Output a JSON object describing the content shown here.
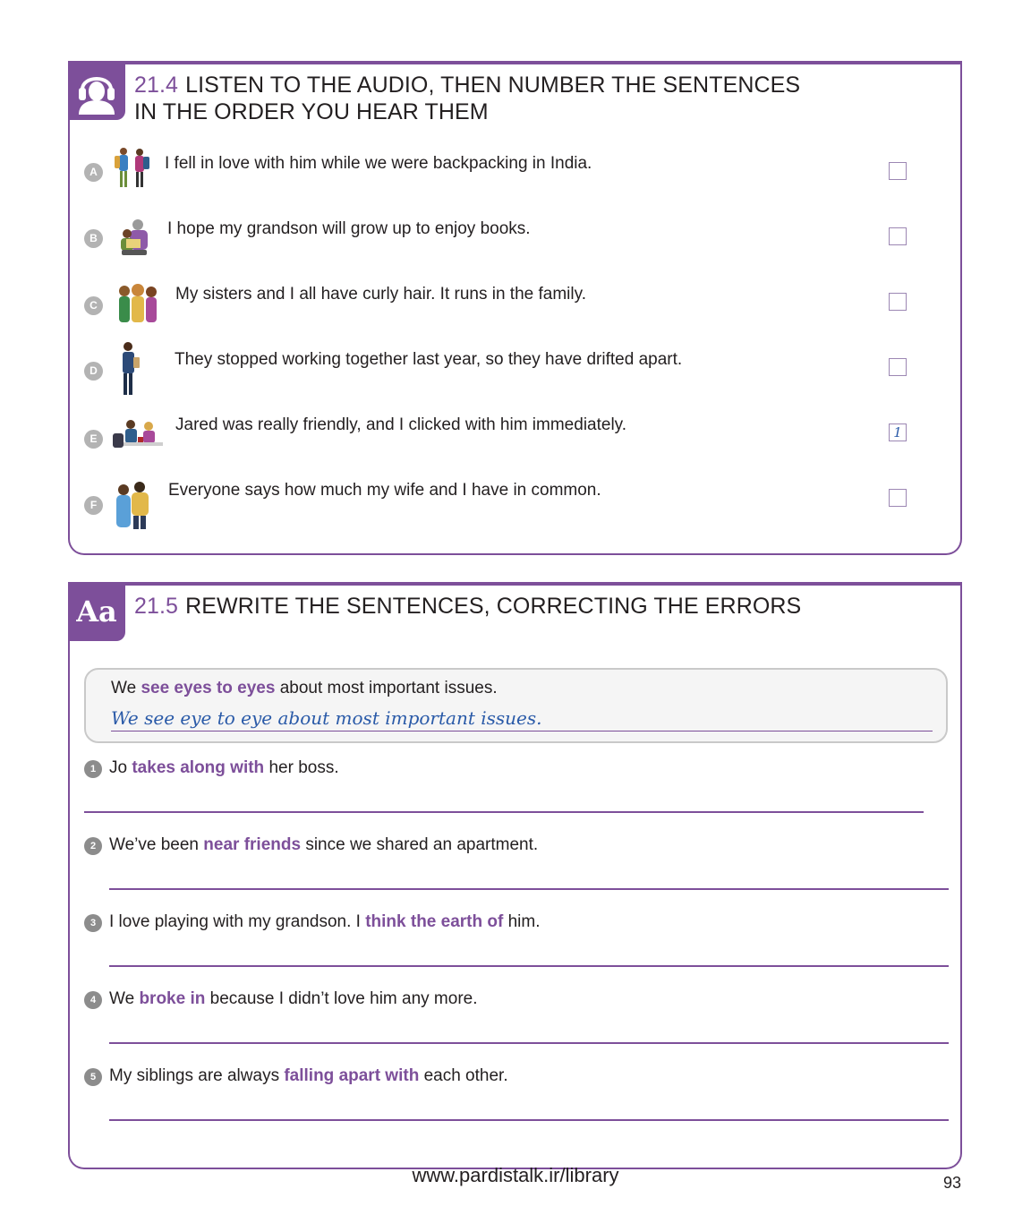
{
  "exercise1": {
    "number": "21.4",
    "title_line1": "LISTEN TO THE AUDIO, THEN NUMBER THE SENTENCES",
    "title_line2": "IN THE ORDER YOU HEAR THEM",
    "icon": "headphones-person-icon",
    "items": [
      {
        "letter": "A",
        "text": "I fell in love with him while we were backpacking in India.",
        "answer": "",
        "picture": "backpackers-picture"
      },
      {
        "letter": "B",
        "text": "I hope my grandson will grow up to enjoy books.",
        "answer": "",
        "picture": "grandmother-reading-picture"
      },
      {
        "letter": "C",
        "text": "My sisters and I all have curly hair. It runs in the family.",
        "answer": "",
        "picture": "sisters-picture"
      },
      {
        "letter": "D",
        "text": "They stopped working together last year, so they have drifted apart.",
        "answer": "",
        "picture": "colleagues-picture"
      },
      {
        "letter": "E",
        "text": "Jared was really friendly, and I clicked with him immediately.",
        "answer": "1",
        "picture": "meeting-picture"
      },
      {
        "letter": "F",
        "text": "Everyone says how much my wife and I have in common.",
        "answer": "",
        "picture": "couple-picture"
      }
    ]
  },
  "exercise2": {
    "number": "21.5",
    "title": "REWRITE THE SENTENCES, CORRECTING THE ERRORS",
    "tab_label": "Aa",
    "example": {
      "before": "We ",
      "error": "see eyes to eyes",
      "after": " about most important issues.",
      "answer": "We see eye to eye about most important issues."
    },
    "questions": [
      {
        "number": "1",
        "before": "Jo ",
        "error": "takes along with",
        "after": " her boss."
      },
      {
        "number": "2",
        "before": "We’ve been ",
        "error": "near friends",
        "after": " since we shared an apartment."
      },
      {
        "number": "3",
        "before": "I love playing with my grandson. I ",
        "error": "think the earth of",
        "after": " him."
      },
      {
        "number": "4",
        "before": "We ",
        "error": "broke in",
        "after": " because I didn’t love him any more."
      },
      {
        "number": "5",
        "before": "My siblings are always ",
        "error": "falling apart with",
        "after": " each other."
      }
    ]
  },
  "footer": {
    "url": "www.pardistalk.ir/library",
    "page_number": "93"
  },
  "colors": {
    "accent": "#7d4f9a",
    "handwriting": "#2a5aa8",
    "letter_badge": "#b3b3b3"
  }
}
